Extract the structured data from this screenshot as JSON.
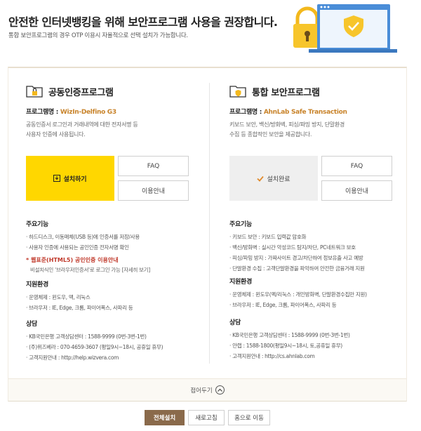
{
  "header": {
    "title": "안전한 인터넷뱅킹을 위해 보안프로그램 사용을 권장합니다.",
    "subtitle": "통합 보안프로그램의 경우 OTP 이용시 자율적으로 선택 설치가 가능합니다."
  },
  "left": {
    "name": "공동인증프로그램",
    "program_label": "프로그램명 : ",
    "program_value": "WizIn-Delfino G3",
    "desc_1": "공동인증서 로그인과 거래내역에 대한 전자서명 등",
    "desc_2": "사용자 인증에 사용됩니다.",
    "install_label": "설치하기",
    "faq_label": "FAQ",
    "guide_label": "이용안내",
    "features_title": "주요기능",
    "features": [
      "하드디스크, 이동매체(USB 등)에 인증서를 저장/사용",
      "사용자 인증에 사용되는 공인인증 전자서명 확인"
    ],
    "note_star": "* ",
    "note_bold": "웹표준(HTML5) 공인인증 이용안내",
    "note_desc": "비설치식인 '브라우저인증서'로 로그인 가능 [자세히 보기]",
    "env_title": "지원환경",
    "env": [
      "운영체제 : 윈도우, 맥, 리눅스",
      "브라우저 : IE, Edge, 크롬, 파이어폭스, 사파리 등"
    ],
    "contact_title": "상담",
    "contact": [
      "KB국민은행 고객상담센터 : 1588-9999 (0번-3번-1번)",
      "(주)위즈베라 : 070-4659-3607 (평일9시~18시, 공휴일 휴무)",
      "고객지원안내 : http://help.wizvera.com"
    ]
  },
  "right": {
    "name": "통합 보안프로그램",
    "program_label": "프로그램명 : ",
    "program_value": "AhnLab Safe Transaction",
    "desc_1": "키보드 보안, 백신/방화벽, 피싱/파밍 방지, 단말환경",
    "desc_2": "수집 등 종합적인 보안을 제공합니다.",
    "install_label": "설치완료",
    "faq_label": "FAQ",
    "guide_label": "이용안내",
    "features_title": "주요기능",
    "features": [
      "키보드 보안 : 키보드 입력값 암호화",
      "백신/방화벽 : 실시간 악성코드 탐지/차단, PC네트워크 보호",
      "피싱/파밍 방지 : 가짜사이트 경고/차단하여 정보유출 사고 예방",
      "단말환경 수집 : 고객단말환경을 파악하여 안전한 금융거래 지원"
    ],
    "env_title": "지원환경",
    "env": [
      "운영체제 : 윈도우(맥/리눅스 : 개인방화벽, 단말환경수집만 지원)",
      "브라우저 : IE, Edge, 크롬, 파이어폭스, 사파리 등"
    ],
    "contact_title": "상담",
    "contact": [
      "KB국민은행 고객상담센터 : 1588-9999 (0번-3번-1번)",
      "안랩 : 1588-1800(평일9시~18시, 토,공휴일 휴무)",
      "고객지원안내 : http://cs.ahnlab.com"
    ]
  },
  "fold_label": "접어두기",
  "footer": {
    "install_all": "전체설치",
    "refresh": "새로고침",
    "home": "홈으로 이동"
  },
  "colors": {
    "accent_yellow": "#ffd700",
    "brown_button": "#8a6a4b",
    "program_value": "#c8832a"
  },
  "icons": [
    "lock-icon",
    "monitor-shield-icon",
    "folder-lock-icon",
    "folder-shield-icon",
    "download-icon",
    "check-icon",
    "chevron-up-icon"
  ]
}
